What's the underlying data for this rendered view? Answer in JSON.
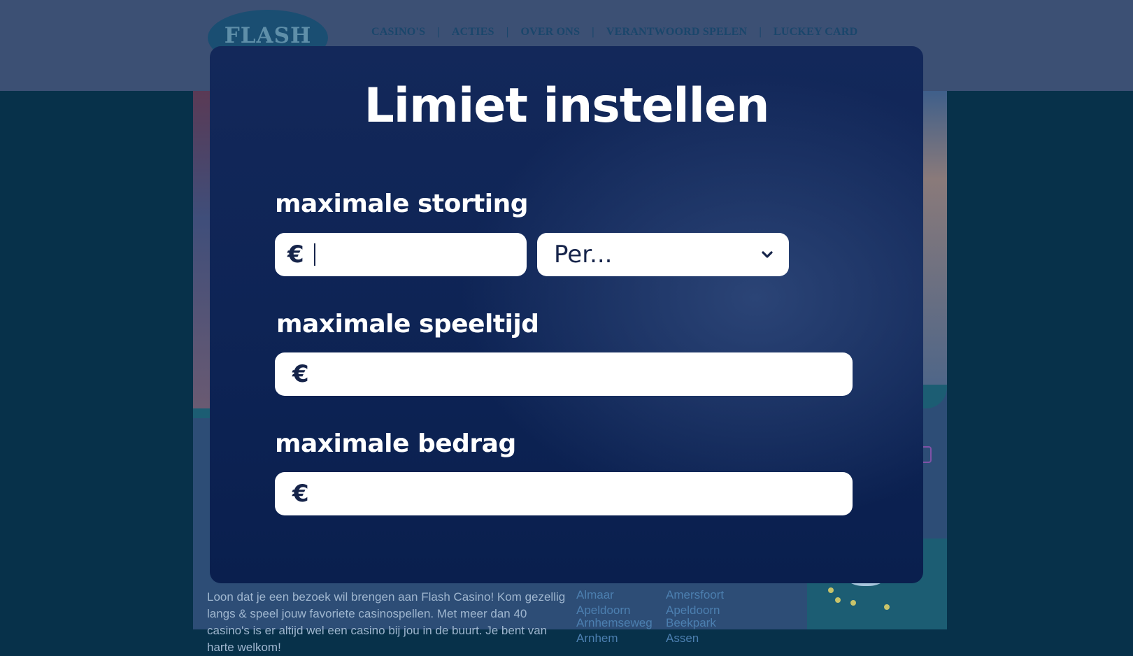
{
  "site": {
    "logo_text": "FLASH",
    "nav": [
      "CASINO'S",
      "ACTIES",
      "OVER ONS",
      "VERANTWOORD SPELEN",
      "LUCKEY CARD"
    ],
    "nav_separator": "|",
    "promo_text": "Loon dat je een bezoek wil brengen aan Flash Casino! Kom gezellig langs & speel jouw favoriete casinospellen. Met meer dan 40 casino's is er altijd wel een casino bij jou in de buurt. Je bent van harte welkom!",
    "locations": [
      [
        "Almaar",
        "Amersfoort"
      ],
      [
        "Apeldoorn Arnhemseweg",
        "Apeldoorn Beekpark"
      ],
      [
        "Arnhem",
        "Assen"
      ]
    ]
  },
  "modal": {
    "title": "Limiet instellen",
    "deposit": {
      "label": "maximale storting",
      "currency": "€",
      "value": "",
      "period_placeholder": "Per..."
    },
    "playtime": {
      "label": "maximale speeltijd",
      "currency": "€",
      "value": ""
    },
    "amount": {
      "label": "maximale bedrag",
      "currency": "€",
      "value": ""
    }
  },
  "icons": {
    "dropdown": "chevron-down-icon"
  },
  "colors": {
    "modal_bg": "#0d2354",
    "field_bg": "#ffffff",
    "text_dark": "#16244a",
    "header_bg": "#3c5074",
    "page_bg": "#07314a"
  }
}
